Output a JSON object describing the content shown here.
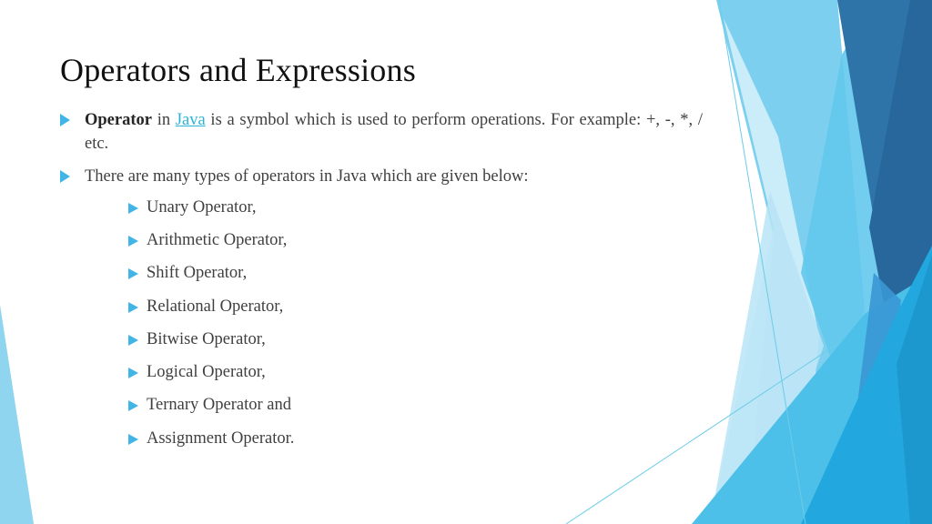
{
  "slide": {
    "title": "Operators and Expressions",
    "bullets": [
      {
        "bold_lead": "Operator",
        "pre_link": " in ",
        "link_text": "Java",
        "post_link": " is a symbol which is used to perform operations. For example: +, -, *, / etc."
      },
      {
        "text": "There are many types of operators in Java which are given below:"
      }
    ],
    "sub_bullets": [
      "Unary Operator,",
      "Arithmetic Operator,",
      "Shift Operator,",
      "Relational Operator,",
      "Bitwise Operator,",
      "Logical Operator,",
      "Ternary Operator and",
      "Assignment Operator."
    ]
  },
  "theme": {
    "accent": "#41b6e6",
    "link": "#2bb3d9",
    "light_blue": "#7ccfef",
    "mid_blue": "#5bc4ea",
    "dark_blue": "#2a6a9e",
    "deep_blue": "#1f8fc8"
  }
}
